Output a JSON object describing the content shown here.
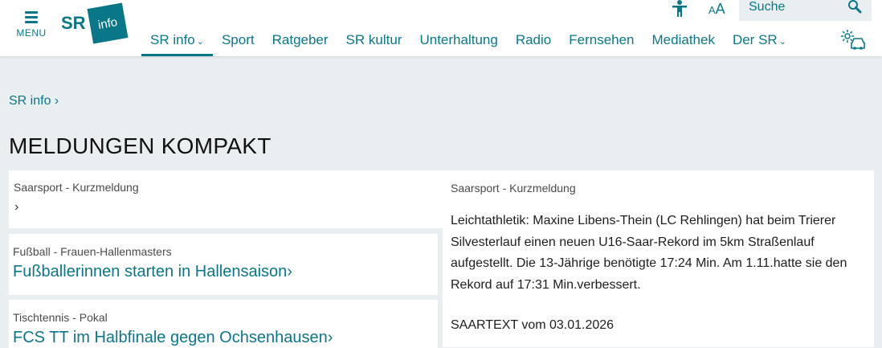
{
  "header": {
    "menu_label": "MENU",
    "logo": {
      "sr": "SR",
      "info": "info"
    },
    "nav": [
      {
        "label": "SR info",
        "active": true,
        "has_dropdown": true
      },
      {
        "label": "Sport",
        "active": false,
        "has_dropdown": false
      },
      {
        "label": "Ratgeber",
        "active": false,
        "has_dropdown": false
      },
      {
        "label": "SR kultur",
        "active": false,
        "has_dropdown": false
      },
      {
        "label": "Unterhaltung",
        "active": false,
        "has_dropdown": false
      },
      {
        "label": "Radio",
        "active": false,
        "has_dropdown": false
      },
      {
        "label": "Fernsehen",
        "active": false,
        "has_dropdown": false
      },
      {
        "label": "Mediathek",
        "active": false,
        "has_dropdown": false
      },
      {
        "label": "Der SR",
        "active": false,
        "has_dropdown": true
      }
    ],
    "font_size_label": {
      "small": "A",
      "large": "A"
    },
    "search_placeholder": "Suche",
    "icons": {
      "accessibility": "accessibility-icon",
      "font_size": "font-size-icon",
      "search": "search-icon",
      "weather_traffic": "weather-traffic-icon"
    }
  },
  "breadcrumb": {
    "label": "SR info ›"
  },
  "page_title": "MELDUNGEN KOMPAKT",
  "cards_left": [
    {
      "kicker_category": "Saarsport",
      "kicker_rest": " - Kurzmeldung",
      "headline": "",
      "arrow": "›"
    },
    {
      "kicker_category": "Fußball",
      "kicker_rest": " - Frauen-Hallenmasters",
      "headline": "Fußballerinnen starten in Hallensaison›"
    },
    {
      "kicker_category": "Tischtennis",
      "kicker_rest": " - Pokal",
      "headline": "FCS TT im Halbfinale gegen Ochsenhausen›"
    }
  ],
  "detail": {
    "kicker": "Saarsport - Kurzmeldung",
    "body": "Leichtathletik: Maxine Libens-Thein (LC Rehlingen) hat beim Trierer Silvesterlauf einen neuen U16-Saar-Rekord im 5km Straßenlauf aufgestellt. Die 13-Jährige benötigte 17:24 Min. Am 1.11.hatte sie den Rekord auf 17:31 Min.verbessert.",
    "source": "SAARTEXT vom 03.01.2026"
  },
  "colors": {
    "accent": "#0a7788",
    "background": "#e9eff0",
    "card": "#ffffff",
    "text": "#1d1d1d"
  }
}
